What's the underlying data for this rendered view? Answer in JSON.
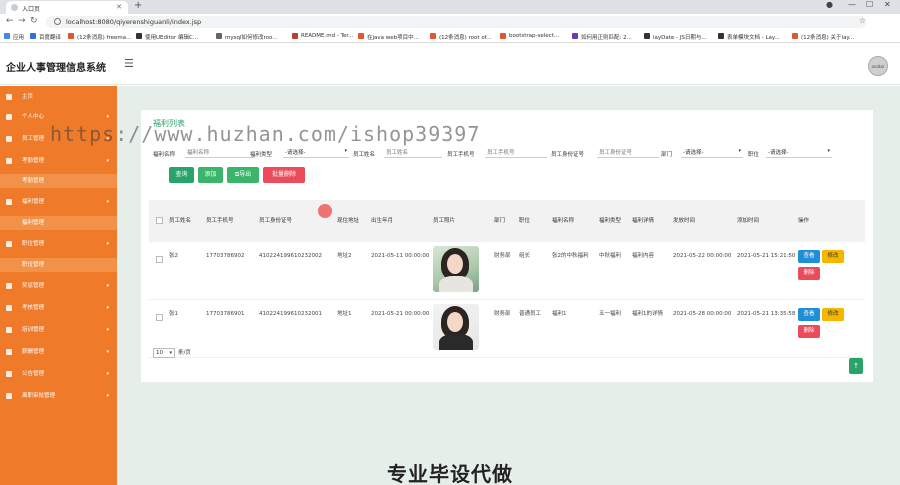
{
  "browser": {
    "tab_title": "入口页",
    "url": "localhost:8080/qiyerenshiguanli/index.jsp",
    "bookmarks": [
      {
        "label": "应用",
        "color": "#4285f4"
      },
      {
        "label": "百度翻译",
        "color": "#2f6ee6"
      },
      {
        "label": "(12条消息) freema...",
        "color": "#e8532f"
      },
      {
        "label": "使用UEditor 编辑C...",
        "color": "#333333"
      },
      {
        "label": "mysql如何修改roo...",
        "color": "#666666"
      },
      {
        "label": "README.md - Ter...",
        "color": "#c0392b"
      },
      {
        "label": "在java web项目中...",
        "color": "#e8532f"
      },
      {
        "label": "(12条消息) root of...",
        "color": "#e8532f"
      },
      {
        "label": "bootstrap-select...",
        "color": "#e8532f"
      },
      {
        "label": "如何用正则匹配: 2...",
        "color": "#6a3ab8"
      },
      {
        "label": "layDate - JS日期与...",
        "color": "#333333"
      },
      {
        "label": "表单模块文档 - Lay...",
        "color": "#333333"
      },
      {
        "label": "(12条消息) 关于lay...",
        "color": "#e8532f"
      }
    ]
  },
  "app": {
    "title": "企业人事管理信息系统",
    "avatar_text": "avatar"
  },
  "sidebar": {
    "items": [
      {
        "label": "主页",
        "has_arrow": false
      },
      {
        "label": "个人中心",
        "has_arrow": true
      },
      {
        "label": "员工管理",
        "has_arrow": true
      },
      {
        "label": "考勤管理",
        "has_arrow": true
      },
      {
        "label": "考勤管理",
        "sub": true
      },
      {
        "label": "福利管理",
        "has_arrow": true
      },
      {
        "label": "福利管理",
        "sub": true
      },
      {
        "label": "职位管理",
        "has_arrow": true
      },
      {
        "label": "职位管理",
        "sub": true
      },
      {
        "label": "奖惩管理",
        "has_arrow": true
      },
      {
        "label": "考核管理",
        "has_arrow": true
      },
      {
        "label": "培训管理",
        "has_arrow": true
      },
      {
        "label": "薪酬管理",
        "has_arrow": true
      },
      {
        "label": "公告管理",
        "has_arrow": true
      },
      {
        "label": "离职审批管理",
        "has_arrow": true
      }
    ]
  },
  "card": {
    "title": "福利列表"
  },
  "filters": {
    "welfare_name_label": "福利名称",
    "welfare_name_placeholder": "福利名称",
    "welfare_type_label": "福利类型",
    "welfare_type_value": "-请选择-",
    "emp_name_label": "员工姓名",
    "emp_name_placeholder": "员工姓名",
    "emp_phone_label": "员工手机号",
    "emp_phone_placeholder": "员工手机号",
    "emp_id_label": "员工身份证号",
    "emp_id_placeholder": "员工身份证号",
    "dept_label": "部门",
    "dept_value": "-请选择-",
    "position_label": "职位",
    "position_value": "-请选择-"
  },
  "buttons": {
    "search": "查询",
    "add": "添加",
    "export": "导出",
    "batch_delete": "批量删除"
  },
  "table": {
    "headers": [
      "员工姓名",
      "员工手机号",
      "员工身份证号",
      "现住地址",
      "出生年月",
      "员工照片",
      "部门",
      "职位",
      "福利名称",
      "福利类型",
      "福利详情",
      "发放时间",
      "添加时间",
      "操作"
    ],
    "rows": [
      {
        "name": "张2",
        "phone": "17703786902",
        "id_card": "410224199610232002",
        "address": "地址2",
        "birth": "2021-05-11 00:00:00",
        "dept": "财务部",
        "position": "组长",
        "welfare_name": "张2的中秋福利",
        "welfare_type": "中秋福利",
        "welfare_detail": "福利内容",
        "issue_time": "2021-05-22 00:00:00",
        "add_time": "2021-05-21 15:21:50"
      },
      {
        "name": "张1",
        "phone": "17703786901",
        "id_card": "410224199610232001",
        "address": "地址1",
        "birth": "2021-05-21 00:00:00",
        "dept": "财务部",
        "position": "普通员工",
        "welfare_name": "福利1",
        "welfare_type": "五一福利",
        "welfare_detail": "福利1的详情",
        "issue_time": "2021-05-28 00:00:00",
        "add_time": "2021-05-21 13:35:58"
      }
    ],
    "actions": {
      "view": "查看",
      "edit": "修改",
      "delete": "删除"
    }
  },
  "pager": {
    "page_size": "10",
    "suffix": "条/页"
  },
  "overlay": {
    "bottom_text": "专业毕设代做",
    "watermark": "https://www.huzhan.com/ishop39397"
  },
  "colors": {
    "sidebar": "#ef7a2a",
    "accent_green": "#2aa36b",
    "btn_add": "#3bb56a",
    "btn_delete": "#ec4b5b",
    "btn_view": "#1f8fd6",
    "btn_edit": "#f6b600"
  }
}
